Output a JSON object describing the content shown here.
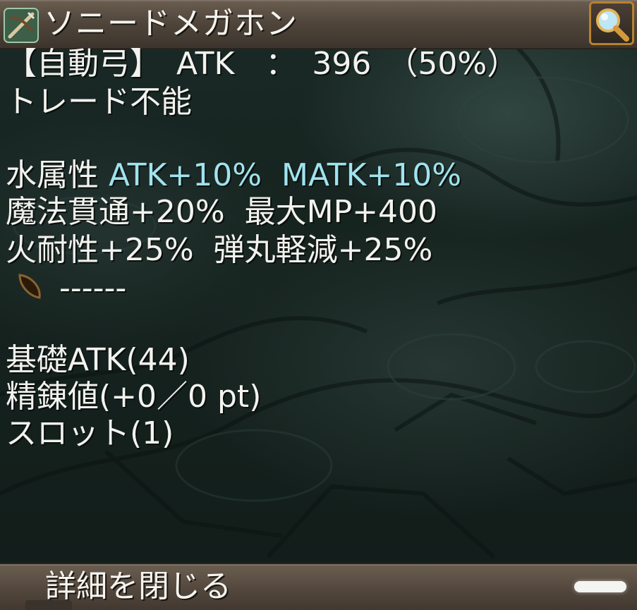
{
  "item": {
    "name": "ソニードメガホン",
    "icon": "crossbow-icon",
    "type_line": "【自動弓】　ATK　：　396　（50%）",
    "trade_line": "トレード不能"
  },
  "element": {
    "label": "水属性",
    "bonus": "ATK+10%  MATK+10%"
  },
  "stats": [
    "魔法貫通+20%  最大MP+400",
    "火耐性+25%  弾丸軽減+25%"
  ],
  "slot": {
    "icon": "leaf-gem-icon",
    "text": "------"
  },
  "base": {
    "atk": "基礎ATK(44)",
    "refine": "精錬値(+0／0 pt)",
    "slots": "スロット(1)"
  },
  "footer": {
    "close_label": "詳細を閉じる"
  },
  "colors": {
    "accent": "#9fe3ee",
    "frame": "#5c4f43",
    "button_border": "#b7822f"
  }
}
